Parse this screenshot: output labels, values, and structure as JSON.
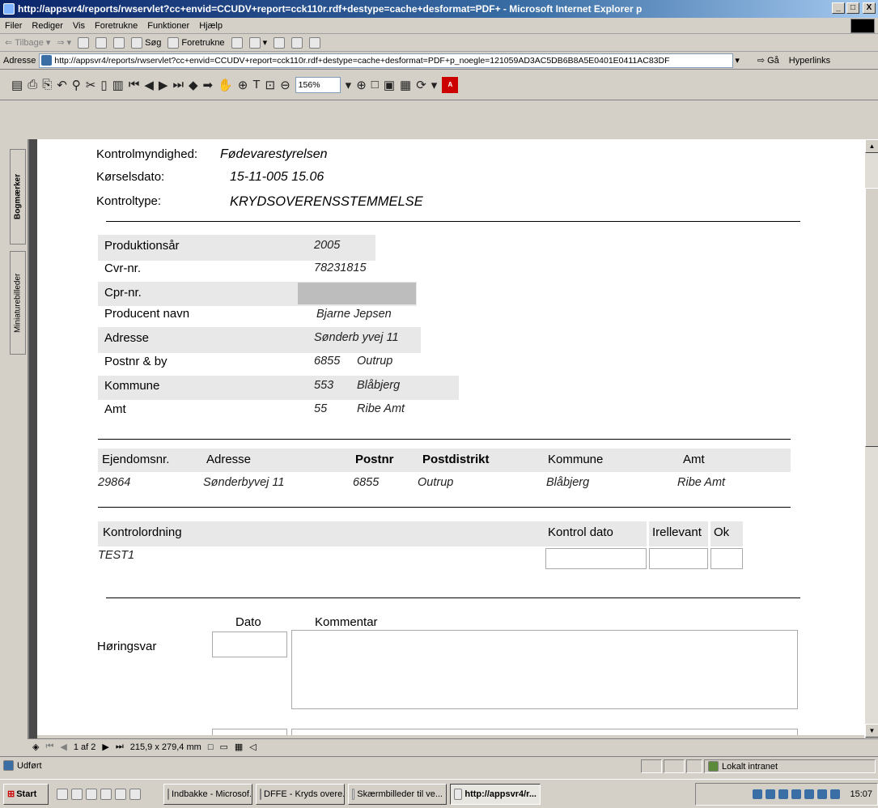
{
  "window": {
    "title": "http://appsvr4/reports/rwservlet?cc+envid=CCUDV+report=cck110r.rdf+destype=cache+desformat=PDF+ - Microsoft Internet Explorer p",
    "minimize": "_",
    "maximize": "□",
    "close": "X"
  },
  "menu": [
    "Filer",
    "Rediger",
    "Vis",
    "Foretrukne",
    "Funktioner",
    "Hjælp"
  ],
  "toolbar": {
    "back": "Tilbage",
    "search": "Søg",
    "favorites": "Foretrukne"
  },
  "address": {
    "label": "Adresse",
    "url": "http://appsvr4/reports/rwservlet?cc+envid=CCUDV+report=cck110r.rdf+destype=cache+desformat=PDF+p_noegle=121059AD3AC5DB6B8A5E0401E0411AC83DF",
    "go": "Gå",
    "links": "Hyperlinks"
  },
  "pdf_toolbar": {
    "zoom": "156%"
  },
  "side_tabs": {
    "bookmarks": "Bogmærker",
    "thumbnails": "Miniaturebilleder"
  },
  "report": {
    "header": {
      "kontrolmyndighed_label": "Kontrolmyndighed:",
      "kontrolmyndighed_value": "Fødevarestyrelsen",
      "koerselsdato_label": "Kørselsdato:",
      "koerselsdato_value": "15-11-005 15.06",
      "kontroltype_label": "Kontroltype:",
      "kontroltype_value": "KRYDSOVERENSSTEMMELSE"
    },
    "producer": {
      "produktionsaar_label": "Produktionsår",
      "produktionsaar_value": "2005",
      "cvr_label": "Cvr-nr.",
      "cvr_value": "78231815",
      "cpr_label": "Cpr-nr.",
      "producent_label": "Producent navn",
      "producent_value": "Bjarne Jepsen",
      "adresse_label": "Adresse",
      "adresse_value": "Sønderb yvej 11",
      "postnr_label": "Postnr & by",
      "postnr_code": "6855",
      "postnr_city": "Outrup",
      "kommune_label": "Kommune",
      "kommune_code": "553",
      "kommune_name": "Blåbjerg",
      "amt_label": "Amt",
      "amt_code": "55",
      "amt_name": "Ribe Amt"
    },
    "property_table": {
      "headers": [
        "Ejendomsnr.",
        "Adresse",
        "Postnr",
        "Postdistrikt",
        "Kommune",
        "Amt"
      ],
      "row": [
        "29864",
        "Sønderbyvej 11",
        "6855",
        "Outrup",
        "Blåbjerg",
        "Ribe Amt"
      ]
    },
    "control_table": {
      "headers": [
        "Kontrolordning",
        "Kontrol dato",
        "Irellevant",
        "Ok"
      ],
      "row": "TEST1"
    },
    "hearing": {
      "dato_label": "Dato",
      "kommentar_label": "Kommentar",
      "hoeringsvar_label": "Høringsvar"
    }
  },
  "nav": {
    "page": "1 af 2",
    "size": "215,9 x 279,4 mm"
  },
  "status": {
    "done": "Udført",
    "zone": "Lokalt intranet"
  },
  "taskbar": {
    "start": "Start",
    "tasks": [
      "Indbakke - Microsof...",
      "DFFE - Kryds overe...",
      "Skærmbilleder til ve...",
      "http://appsvr4/r..."
    ],
    "clock": "15:07"
  }
}
